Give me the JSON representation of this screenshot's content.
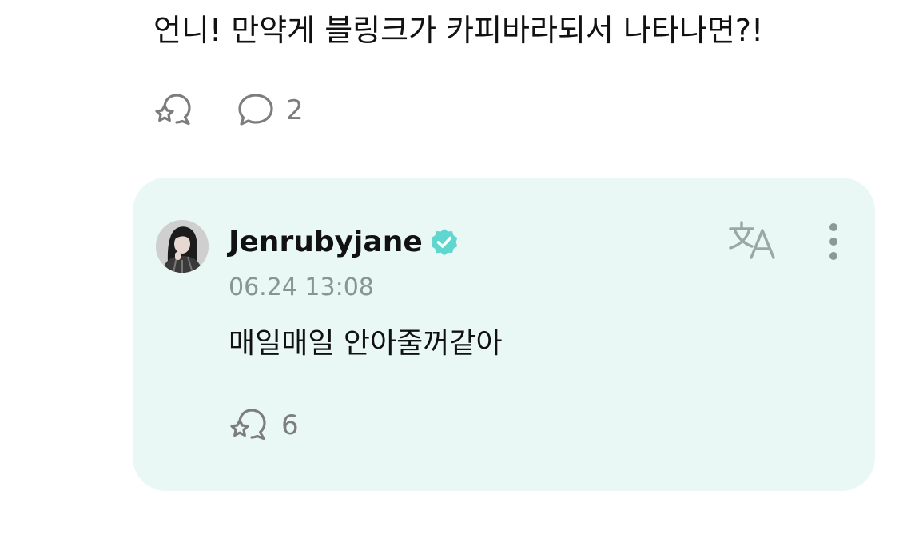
{
  "post": {
    "text": "언니! 만약게 블링크가 카피바라되서 나타나면?!",
    "comment_count": "2"
  },
  "reply": {
    "author": "Jenrubyjane",
    "timestamp": "06.24 13:08",
    "text": "매일매일 안아줄꺼같아",
    "reaction_count": "6"
  },
  "icons": {
    "reaction": "bubble-star-icon",
    "comment": "speech-bubble-icon",
    "verified": "verified-badge-icon",
    "translate": "translate-icon",
    "more": "vertical-dots-icon"
  },
  "colors": {
    "card_background": "#e9f8f5",
    "verified_badge": "#5fd7cf",
    "muted_text": "#8a9592",
    "icon_gray": "#7d7d7d",
    "translate_icon": "#9aa7a4"
  }
}
